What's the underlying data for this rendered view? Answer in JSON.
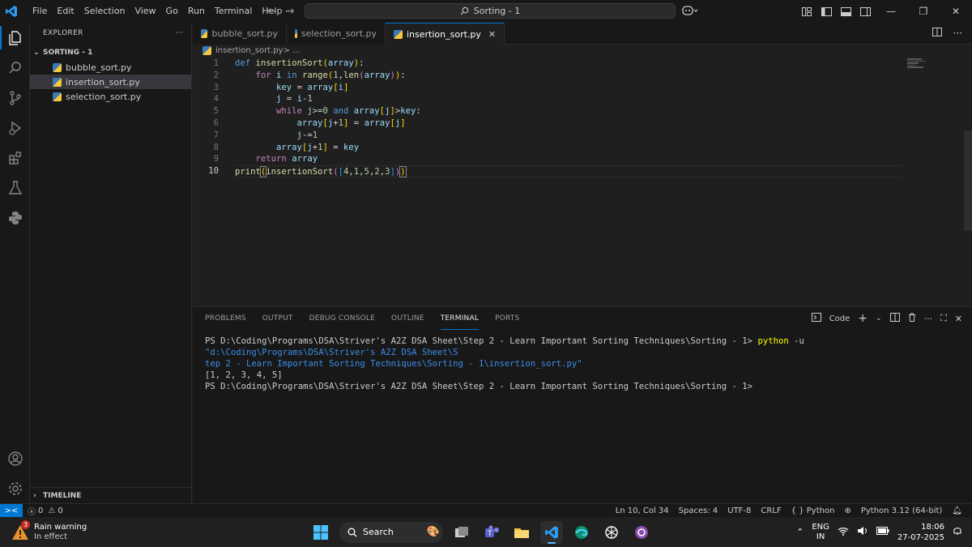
{
  "titlebar": {
    "menu": [
      "File",
      "Edit",
      "Selection",
      "View",
      "Go",
      "Run",
      "Terminal",
      "Help"
    ],
    "command_center": "Sorting - 1"
  },
  "explorer": {
    "title": "EXPLORER",
    "folder": "SORTING - 1",
    "files": [
      "bubble_sort.py",
      "insertion_sort.py",
      "selection_sort.py"
    ],
    "timeline": "TIMELINE"
  },
  "tabs": [
    "bubble_sort.py",
    "selection_sort.py",
    "insertion_sort.py"
  ],
  "breadcrumb": {
    "file": "insertion_sort.py",
    "rest": " > ..."
  },
  "code": {
    "line_numbers": [
      "1",
      "2",
      "3",
      "4",
      "5",
      "6",
      "7",
      "8",
      "9",
      "10"
    ]
  },
  "panel": {
    "tabs": [
      "PROBLEMS",
      "OUTPUT",
      "DEBUG CONSOLE",
      "OUTLINE",
      "TERMINAL",
      "PORTS"
    ],
    "shell": "Code",
    "terminal": {
      "prompt1": "PS D:\\Coding\\Programs\\DSA\\Striver's A2Z DSA Sheet\\Step 2 - Learn Important Sorting Techniques\\Sorting - 1> ",
      "cmd": "python",
      "flag": " -u ",
      "arg_line1": "\"d:\\Coding\\Programs\\DSA\\Striver's A2Z DSA Sheet\\S",
      "arg_line2": "tep 2 - Learn Important Sorting Techniques\\Sorting - 1\\insertion_sort.py\"",
      "output": "[1, 2, 3, 4, 5]",
      "prompt2": "PS D:\\Coding\\Programs\\DSA\\Striver's A2Z DSA Sheet\\Step 2 - Learn Important Sorting Techniques\\Sorting - 1>"
    }
  },
  "status": {
    "errors": "0",
    "warnings": "0",
    "position": "Ln 10, Col 34",
    "spaces": "Spaces: 4",
    "encoding": "UTF-8",
    "eol": "CRLF",
    "language": "Python",
    "interpreter": "Python 3.12 (64-bit)"
  },
  "taskbar": {
    "weather_title": "Rain warning",
    "weather_sub": "In effect",
    "weather_badge": "3",
    "search": "Search",
    "lang": "ENG",
    "region": "IN",
    "time": "18:06",
    "date": "27-07-2025"
  },
  "colors": {
    "accent": "#0078d4",
    "editor_bg": "#1f1f1f",
    "sidebar_bg": "#181818"
  }
}
